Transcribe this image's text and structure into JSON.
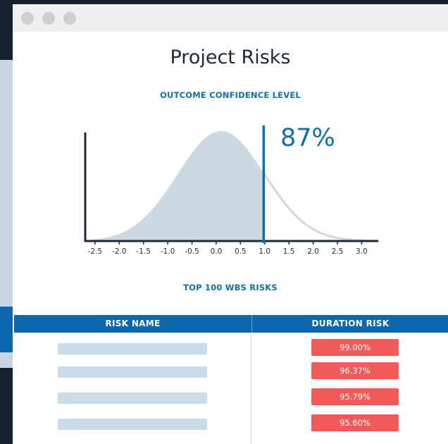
{
  "window": {
    "title_bar_controls": [
      "close-control",
      "minimize-control",
      "zoom-control"
    ]
  },
  "page": {
    "title": "Project Risks"
  },
  "confidence": {
    "label": "OUTCOME CONFIDENCE LEVEL",
    "value_text": "87%"
  },
  "chart_data": {
    "type": "area",
    "title": "OUTCOME CONFIDENCE LEVEL",
    "x_ticks": [
      "-2.5",
      "-2.0",
      "-1.5",
      "-1.0",
      "-0.5",
      "0.0",
      "0.5",
      "1.0",
      "1.5",
      "2.0",
      "2.5",
      "3.0"
    ],
    "xlim": [
      -2.6,
      3.3
    ],
    "distribution": "normal",
    "mean": 0.1,
    "std": 0.9,
    "threshold_x": 0.98,
    "confidence_percent": 87,
    "shaded_region": "left of threshold",
    "colors": {
      "fill": "#ccd9e3",
      "curve": "#ccd9e3",
      "axis": "#1b2a37",
      "threshold": "#0f6fb0"
    }
  },
  "risks": {
    "label": "TOP 100 WBS RISKS",
    "columns": [
      "RISK NAME",
      "DURATION RISK"
    ],
    "rows": [
      {
        "duration_risk": "99.00%"
      },
      {
        "duration_risk": "96.37%"
      },
      {
        "duration_risk": "95.79%"
      },
      {
        "duration_risk": "95.60%"
      }
    ]
  },
  "colors": {
    "accent": "#0e67ad",
    "risk_badge": "#f25a5a",
    "placeholder_bar": "#c9dcea",
    "background": "#14212d"
  }
}
